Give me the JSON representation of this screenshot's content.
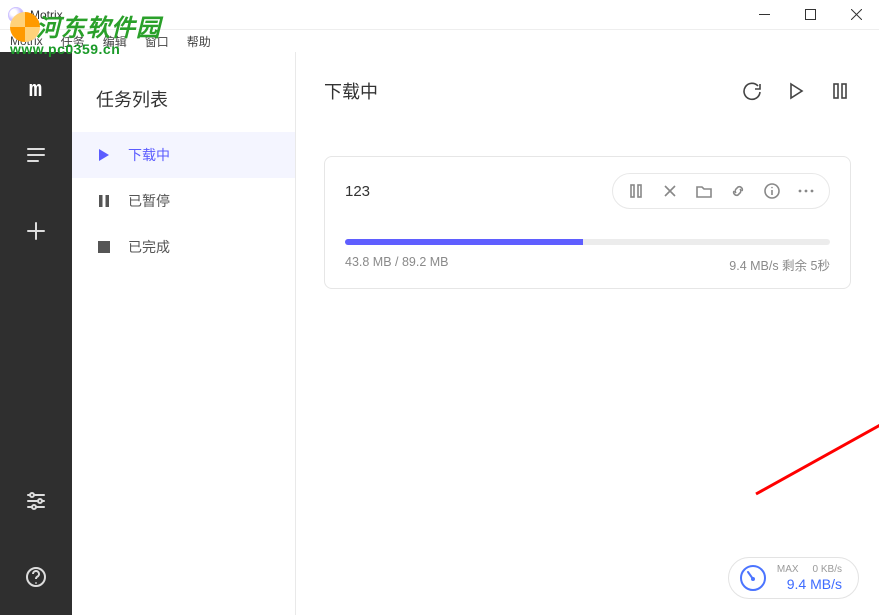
{
  "window": {
    "title": "Motrix"
  },
  "menu": {
    "items": [
      "Motrix",
      "任务",
      "编辑",
      "窗口",
      "帮助"
    ]
  },
  "watermark": {
    "text": "河东软件园",
    "url": "www.pc0359.cn"
  },
  "rail": {
    "logo": "m",
    "items": [
      "tasks-icon",
      "list-icon",
      "add-icon"
    ],
    "bottom": [
      "preferences-icon",
      "help-icon"
    ]
  },
  "sidebar": {
    "title": "任务列表",
    "items": [
      {
        "icon": "play",
        "label": "下载中",
        "active": true
      },
      {
        "icon": "pause",
        "label": "已暂停",
        "active": false
      },
      {
        "icon": "stop",
        "label": "已完成",
        "active": false
      }
    ]
  },
  "main": {
    "title": "下载中",
    "actions": [
      "refresh",
      "resume-all",
      "pause-all"
    ]
  },
  "task": {
    "name": "123",
    "progress_pct": 49,
    "size_text": "43.8 MB / 89.2 MB",
    "speed_eta": "9.4 MB/s 剩余 5秒",
    "actions": [
      "pause",
      "delete",
      "folder",
      "link",
      "info",
      "more"
    ]
  },
  "speed": {
    "max_label": "MAX",
    "upload": "0 KB/s",
    "download": "9.4 MB/s"
  }
}
